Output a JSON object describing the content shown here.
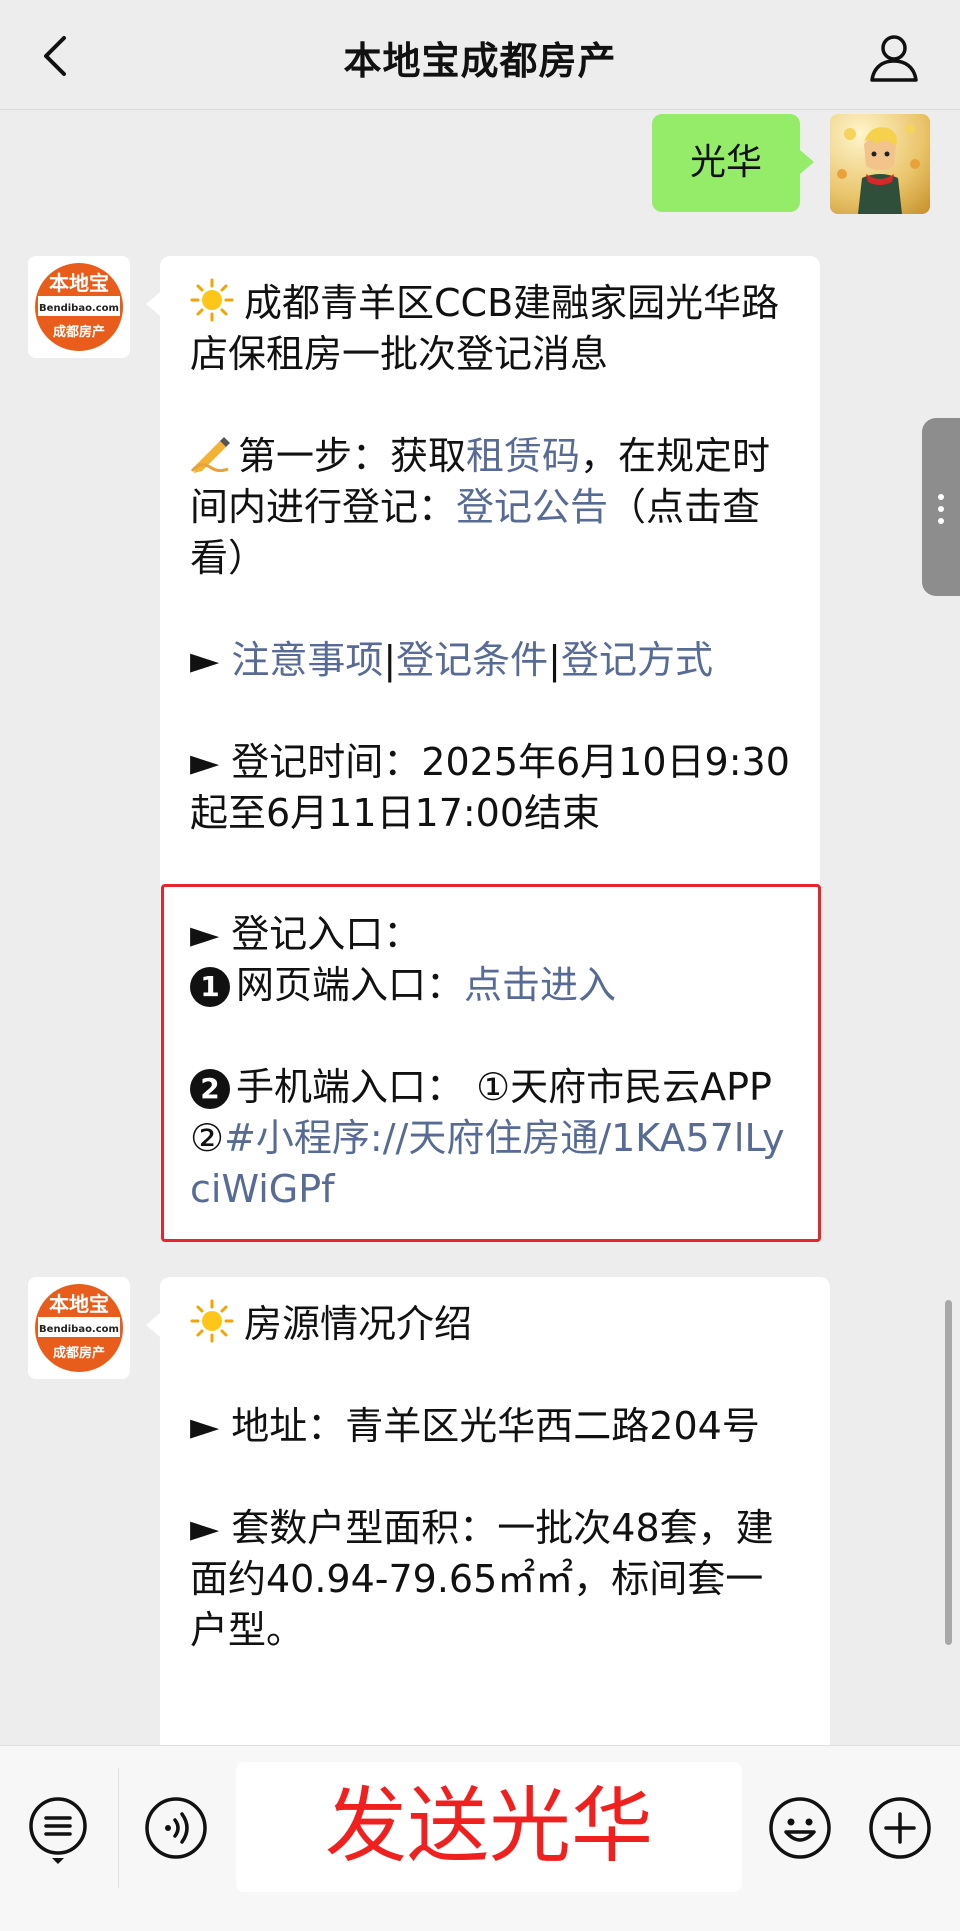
{
  "header": {
    "title": "本地宝成都房产"
  },
  "sent_message": {
    "text": "光华"
  },
  "bot": {
    "logo_top": "本地宝",
    "logo_mid": "Bendibao.com",
    "logo_bottom": "成都房产"
  },
  "message1": {
    "title": "成都青羊区CCB建融家园光华路店保租房一批次登记消息",
    "step_prefix": "第一步：获取",
    "step_link1": "租赁码",
    "step_mid": "，在规定时间内进行登记：",
    "step_link2": "登记公告",
    "step_suffix": "（点击查看）",
    "links_prefix": "► ",
    "link_a": "注意事项",
    "sep1": "|",
    "link_b": "登记条件",
    "sep2": "|",
    "link_c": "登记方式",
    "time_line": "► 登记时间：2025年6月10日9:30起至6月11日17:00结束",
    "entry_title": "► 登记入口：",
    "web_num": "1",
    "web_label": "网页端入口：",
    "web_link": "点击进入",
    "mobile_num": "2",
    "mobile_label": "手机端入口：  ①天府市民云APP ②",
    "mobile_link": "#小程序://天府住房通/1KA57lLyciWiGPf"
  },
  "message2": {
    "title": "房源情况介绍",
    "address": "► 地址：青羊区光华西二路204号",
    "units": "► 套数户型面积：一批次48套，建面约40.94-79.65㎡㎡，标间套一户型。"
  },
  "input": {
    "text": "发送光华"
  },
  "icons": {
    "back": "chevron-left-icon",
    "profile": "person-icon",
    "menu": "list-icon",
    "voice": "voice-icon",
    "emoji": "smile-icon",
    "plus": "plus-icon"
  },
  "colors": {
    "background": "#ededed",
    "sent_bubble": "#95ec69",
    "link": "#576b95",
    "highlight_box": "#e6262c",
    "input_text": "#f0201f"
  }
}
